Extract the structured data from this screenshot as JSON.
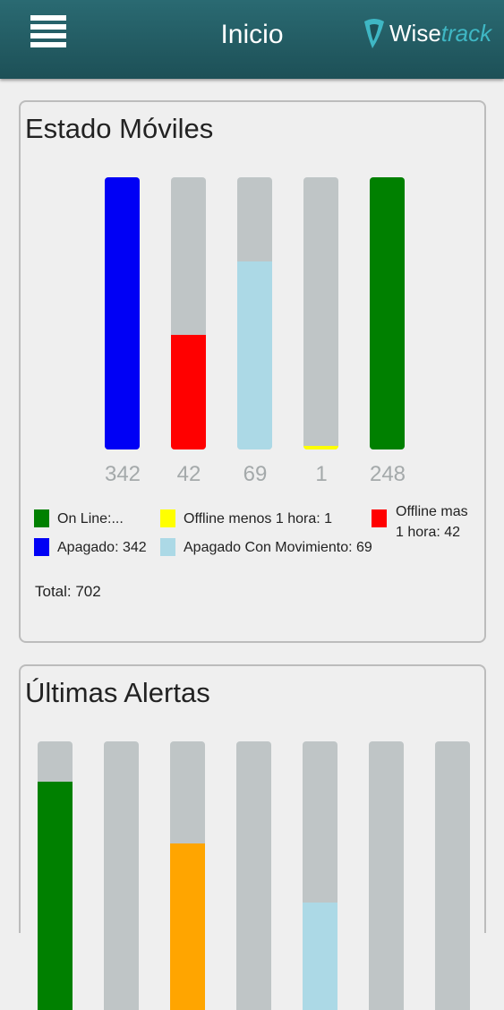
{
  "header": {
    "title": "Inicio",
    "logo_main": "Wise",
    "logo_accent": "track",
    "menu_icon": "hamburger-menu-icon"
  },
  "estado": {
    "title": "Estado Móviles",
    "bars": [
      {
        "key": "apagado",
        "value": "342",
        "fraction": 1.0,
        "color": "#0000f5"
      },
      {
        "key": "offline_mas",
        "value": "42",
        "fraction": 0.42,
        "color": "#ff0000"
      },
      {
        "key": "apagado_mov",
        "value": "69",
        "fraction": 0.69,
        "color": "#acd9e6"
      },
      {
        "key": "offline_menos",
        "value": "1",
        "fraction": 0.012,
        "color": "#ffff00"
      },
      {
        "key": "online",
        "value": "248",
        "fraction": 1.0,
        "color": "#008000"
      }
    ],
    "legend": {
      "online": "On Line:...",
      "offline_menos": "Offline menos 1 hora: 1",
      "offline_mas_1": "Offline mas",
      "offline_mas_2": "1 hora: 42",
      "apagado": "Apagado: 342",
      "apagado_mov": "Apagado Con Movimiento: 69"
    },
    "colors": {
      "online": "#008000",
      "offline_menos": "#ffff00",
      "offline_mas": "#ff0000",
      "apagado": "#0000f5",
      "apagado_mov": "#acd9e6"
    },
    "total": "Total: 702"
  },
  "alertas": {
    "title": "Últimas Alertas",
    "bars": [
      {
        "fraction": 0.85,
        "color": "#008000"
      },
      {
        "fraction": 0.0,
        "color": "#bfc5c6"
      },
      {
        "fraction": 0.62,
        "color": "#ffa500"
      },
      {
        "fraction": 0.0,
        "color": "#bfc5c6"
      },
      {
        "fraction": 0.4,
        "color": "#acd9e6"
      },
      {
        "fraction": 0.0,
        "color": "#bfc5c6"
      },
      {
        "fraction": 0.0,
        "color": "#bfc5c6"
      }
    ]
  }
}
